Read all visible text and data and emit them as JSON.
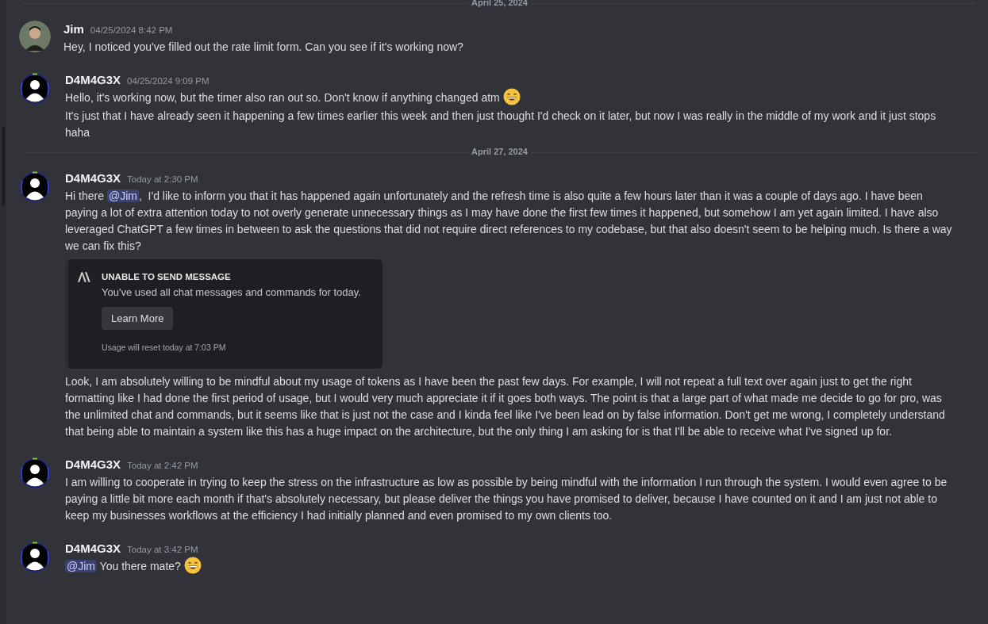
{
  "items": [
    {
      "kind": "separator",
      "label": "April 25, 2024"
    },
    {
      "kind": "message",
      "author": "Jim",
      "avatar": {
        "kind": "photo"
      },
      "time": "04/25/2024 8:42 PM",
      "blocks": [
        {
          "kind": "text",
          "spans": [
            {
              "kind": "text",
              "text": "Hey, I noticed you've filled out the rate limit form. Can you see if it's working now?"
            }
          ]
        }
      ]
    },
    {
      "kind": "message",
      "author": "D4M4G3X",
      "avatar": {
        "kind": "silhouette"
      },
      "time": "04/25/2024 9:09 PM",
      "blocks": [
        {
          "kind": "text",
          "spans": [
            {
              "kind": "text",
              "text": "Hello, it's working now, but the timer also ran out so. Don't know if anything changed atm"
            },
            {
              "kind": "emoji"
            }
          ]
        },
        {
          "kind": "text",
          "spans": [
            {
              "kind": "text",
              "text": "It's just that I have already seen it happening a few times earlier this week and then just thought I'd check on it later, but now I was really in the middle of my work and it just stops haha"
            }
          ]
        }
      ]
    },
    {
      "kind": "separator",
      "label": "April 27, 2024"
    },
    {
      "kind": "message",
      "author": "D4M4G3X",
      "avatar": {
        "kind": "silhouette"
      },
      "time": "Today at 2:30 PM",
      "blocks": [
        {
          "kind": "text",
          "spans": [
            {
              "kind": "text",
              "text": "Hi there "
            },
            {
              "kind": "mention",
              "text": "@Jim"
            },
            {
              "kind": "text",
              "text": ",  I'd like to inform you that it has happened again unfortunately and the refresh time is also quite a few hours later than it was a couple of days ago. I have been paying a lot of extra attention today to not overly generate unnecessary things as I may have done the first few times it happened, but somehow I am yet again limited. I have also leveraged ChatGPT a few times in between to ask the questions that did not require direct references to my codebase, but that also doesn't seem to be helping much. Is there a way we can fix this?"
            }
          ]
        },
        {
          "kind": "embed",
          "title": "UNABLE TO SEND MESSAGE",
          "description": "You've used all chat messages and commands for today.",
          "button": "Learn More",
          "footer": "Usage will reset today at 7:03 PM"
        },
        {
          "kind": "text",
          "spans": [
            {
              "kind": "text",
              "text": "Look, I am absolutely willing to be mindful about my usage of tokens as I have been the past few days. For example, I will not repeat a full text over again just to get the right formatting like I had done the first period of usage, but I would very much appreciate it if it goes both ways. The point is that a large part of what made me decide to go for pro, was the unlimited chat and commands, but it seems like that is just not the case and I kinda feel like I've been lead on by false information. Don't get me wrong, I completely understand that being able to maintain a system like this has a huge impact on the architecture, but the only thing I am asking for is that I'll be able to receive what I've signed up for."
            }
          ]
        }
      ]
    },
    {
      "kind": "message",
      "author": "D4M4G3X",
      "avatar": {
        "kind": "silhouette"
      },
      "time": "Today at 2:42 PM",
      "blocks": [
        {
          "kind": "text",
          "spans": [
            {
              "kind": "text",
              "text": "I am willing to cooperate in trying to keep the stress on the infrastructure as low as possible by being mindful with the information I run through the system. I would even agree to be paying a little bit more each month if that's absolutely necessary, but please deliver the things you have promised to deliver, because I have counted on it and I am just not able to keep my businesses workflows at the efficiency I had initially planned and even promised to my own clients too."
            }
          ]
        }
      ]
    },
    {
      "kind": "message",
      "author": "D4M4G3X",
      "avatar": {
        "kind": "silhouette"
      },
      "time": "Today at 3:42 PM",
      "blocks": [
        {
          "kind": "text",
          "spans": [
            {
              "kind": "mention",
              "text": "@Jim"
            },
            {
              "kind": "text",
              "text": " You there mate?"
            },
            {
              "kind": "emoji"
            }
          ]
        }
      ]
    }
  ]
}
